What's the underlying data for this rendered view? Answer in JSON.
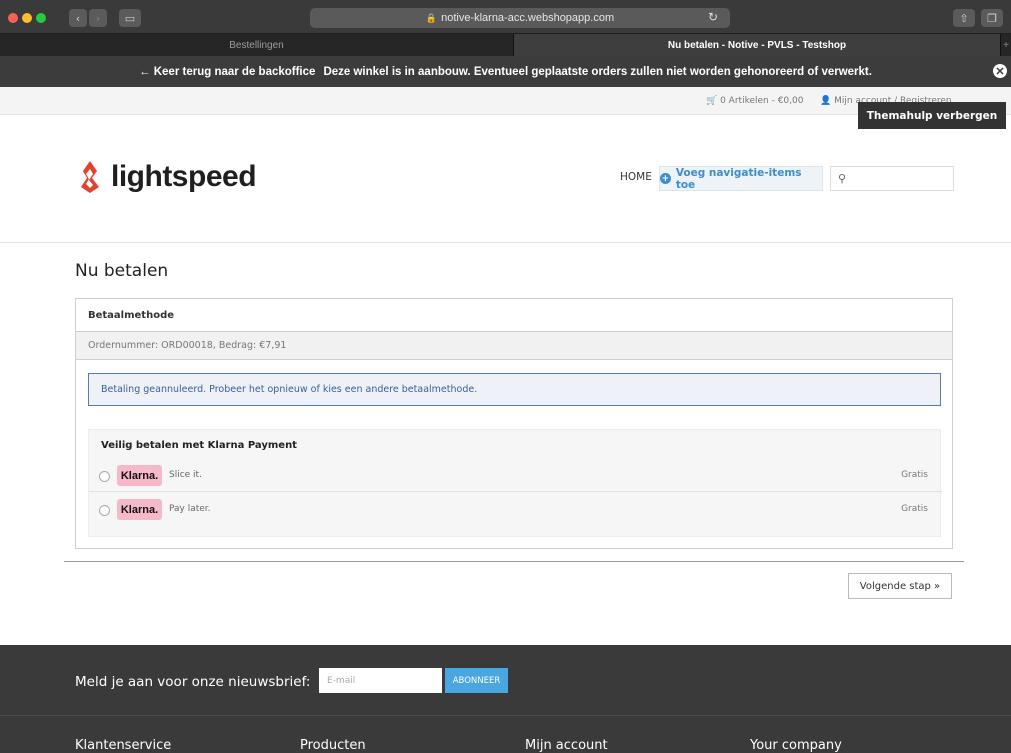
{
  "browser": {
    "url": "notive-klarna-acc.webshopapp.com",
    "tabs": [
      {
        "label": "Bestellingen",
        "active": false
      },
      {
        "label": "Nu betalen - Notive - PVLS - Testshop",
        "active": true
      }
    ]
  },
  "notice": {
    "back": "← Keer terug naar de backoffice",
    "message": "Deze winkel is in aanbouw. Eventueel geplaatste orders zullen niet worden gehonoreerd of verwerkt."
  },
  "topbar": {
    "cart": "0 Artikelen - €0,00",
    "account": "Mijn account / Registreren",
    "themahulp": "Themahulp verbergen"
  },
  "header": {
    "logo_text": "lightspeed",
    "nav_home": "HOME",
    "nav_add": "Voeg navigatie-items toe"
  },
  "main": {
    "title": "Nu betalen",
    "panel_heading": "Betaalmethode",
    "order_info": "Ordernummer: ORD00018, Bedrag: €7,91",
    "alert": "Betaling geannuleerd. Probeer het opnieuw of kies een andere betaalmethode.",
    "methods_title": "Veilig betalen met Klarna Payment",
    "methods": [
      {
        "brand": "Klarna.",
        "label": "Slice it.",
        "price": "Gratis"
      },
      {
        "brand": "Klarna.",
        "label": "Pay later.",
        "price": "Gratis"
      }
    ],
    "next_button": "Volgende stap »"
  },
  "footer": {
    "newsletter_label": "Meld je aan voor onze nieuwsbrief:",
    "email_placeholder": "E-mail",
    "subscribe": "ABONNEER",
    "columns": [
      "Klantenservice",
      "Producten",
      "Mijn account",
      "Your company"
    ]
  },
  "colors": {
    "accent": "#3d8ec9",
    "klarna_pink": "#f7b8c9",
    "logo_red": "#e4402e",
    "footer_bg": "#3a3a3a"
  }
}
